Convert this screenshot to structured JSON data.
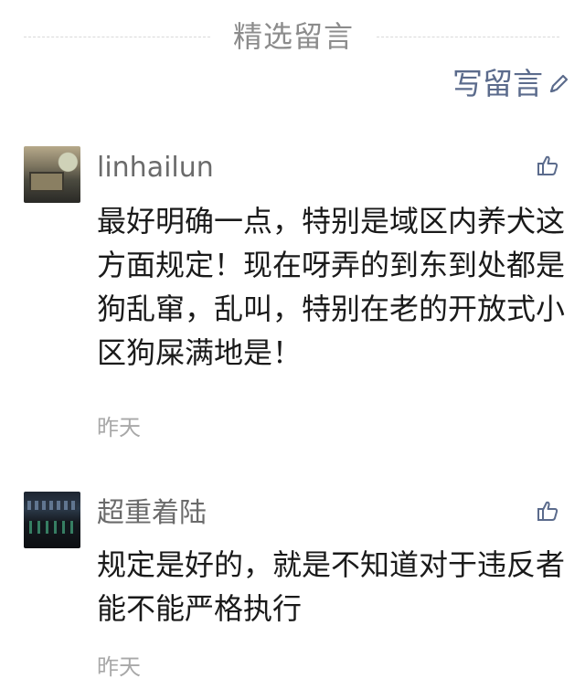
{
  "header": {
    "title": "精选留言",
    "write_label": "写留言",
    "write_icon": "pencil-icon"
  },
  "comments": [
    {
      "nickname": "linhailun",
      "text": "最好明确一点，特别是域区内养犬这方面规定！现在呀弄的到东到处都是狗乱窜，乱叫，特别在老的开放式小区狗屎满地是！",
      "time": "昨天",
      "like_icon": "thumbs-up-icon"
    },
    {
      "nickname": "超重着陆",
      "text": "规定是好的，就是不知道对于违反者能不能严格执行",
      "time": "昨天",
      "like_icon": "thumbs-up-icon"
    }
  ],
  "colors": {
    "title": "#8c8c8c",
    "link": "#5b6b8c",
    "nickname": "#6b6b6b",
    "time": "#a8a8a8"
  }
}
